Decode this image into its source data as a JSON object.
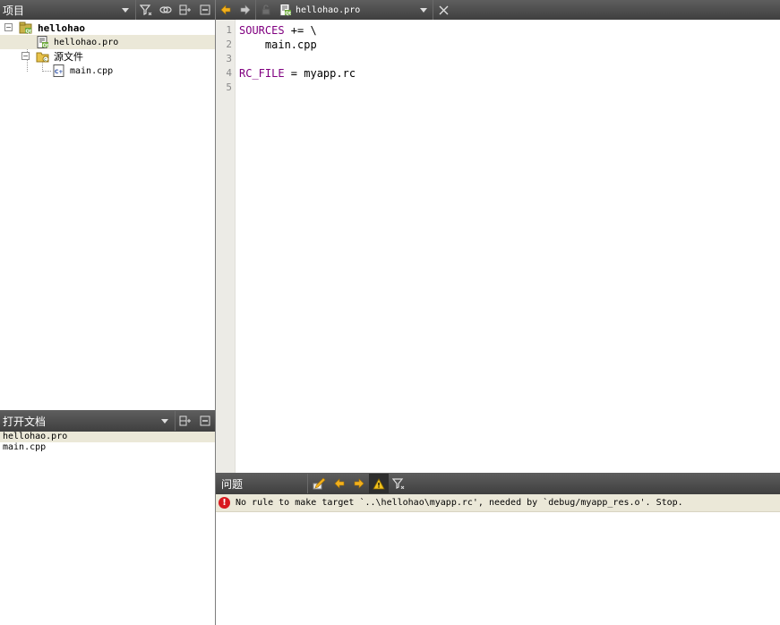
{
  "project_panel": {
    "title": "项目",
    "tree": {
      "root_label": "hellohao",
      "pro_file_label": "hellohao.pro",
      "sources_folder_label": "源文件",
      "main_cpp_label": "main.cpp"
    }
  },
  "open_docs_panel": {
    "title": "打开文档",
    "items": [
      "hellohao.pro",
      "main.cpp"
    ]
  },
  "editor": {
    "current_file": "hellohao.pro",
    "line_numbers": [
      "1",
      "2",
      "3",
      "4",
      "5"
    ],
    "lines": [
      {
        "kw": "SOURCES",
        "rest": " += \\"
      },
      {
        "kw": "",
        "rest": "    main.cpp"
      },
      {
        "kw": "",
        "rest": ""
      },
      {
        "kw": "RC_FILE",
        "rest": " = myapp.rc"
      },
      {
        "kw": "",
        "rest": ""
      }
    ],
    "colors": {
      "keyword": "#800080"
    }
  },
  "issues_panel": {
    "title": "问题",
    "issues": [
      {
        "type": "error",
        "message": "No rule to make target `..\\hellohao\\myapp.rc', needed by `debug/myapp_res.o'.  Stop."
      }
    ]
  }
}
